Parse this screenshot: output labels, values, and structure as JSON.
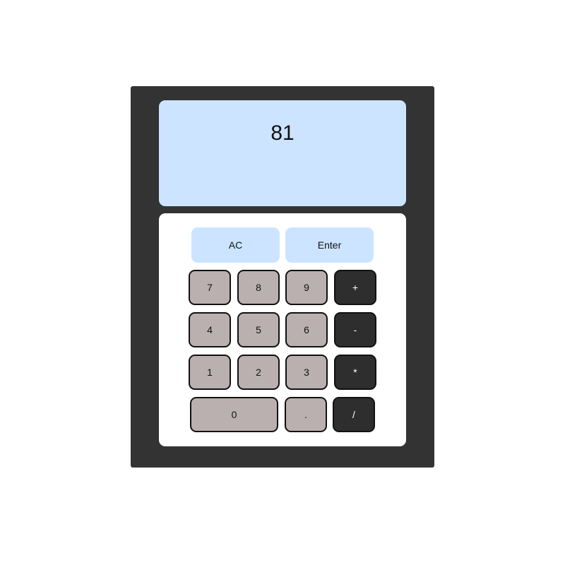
{
  "display": {
    "value": "81"
  },
  "keys": {
    "clear": "AC",
    "enter": "Enter",
    "seven": "7",
    "eight": "8",
    "nine": "9",
    "plus": "+",
    "four": "4",
    "five": "5",
    "six": "6",
    "minus": "-",
    "one": "1",
    "two": "2",
    "three": "3",
    "multiply": "*",
    "zero": "0",
    "decimal": ".",
    "divide": "/"
  },
  "colors": {
    "body": "#333333",
    "display": "#cce4ff",
    "number_key": "#bab0af",
    "operator_key": "#2e2e2e"
  }
}
